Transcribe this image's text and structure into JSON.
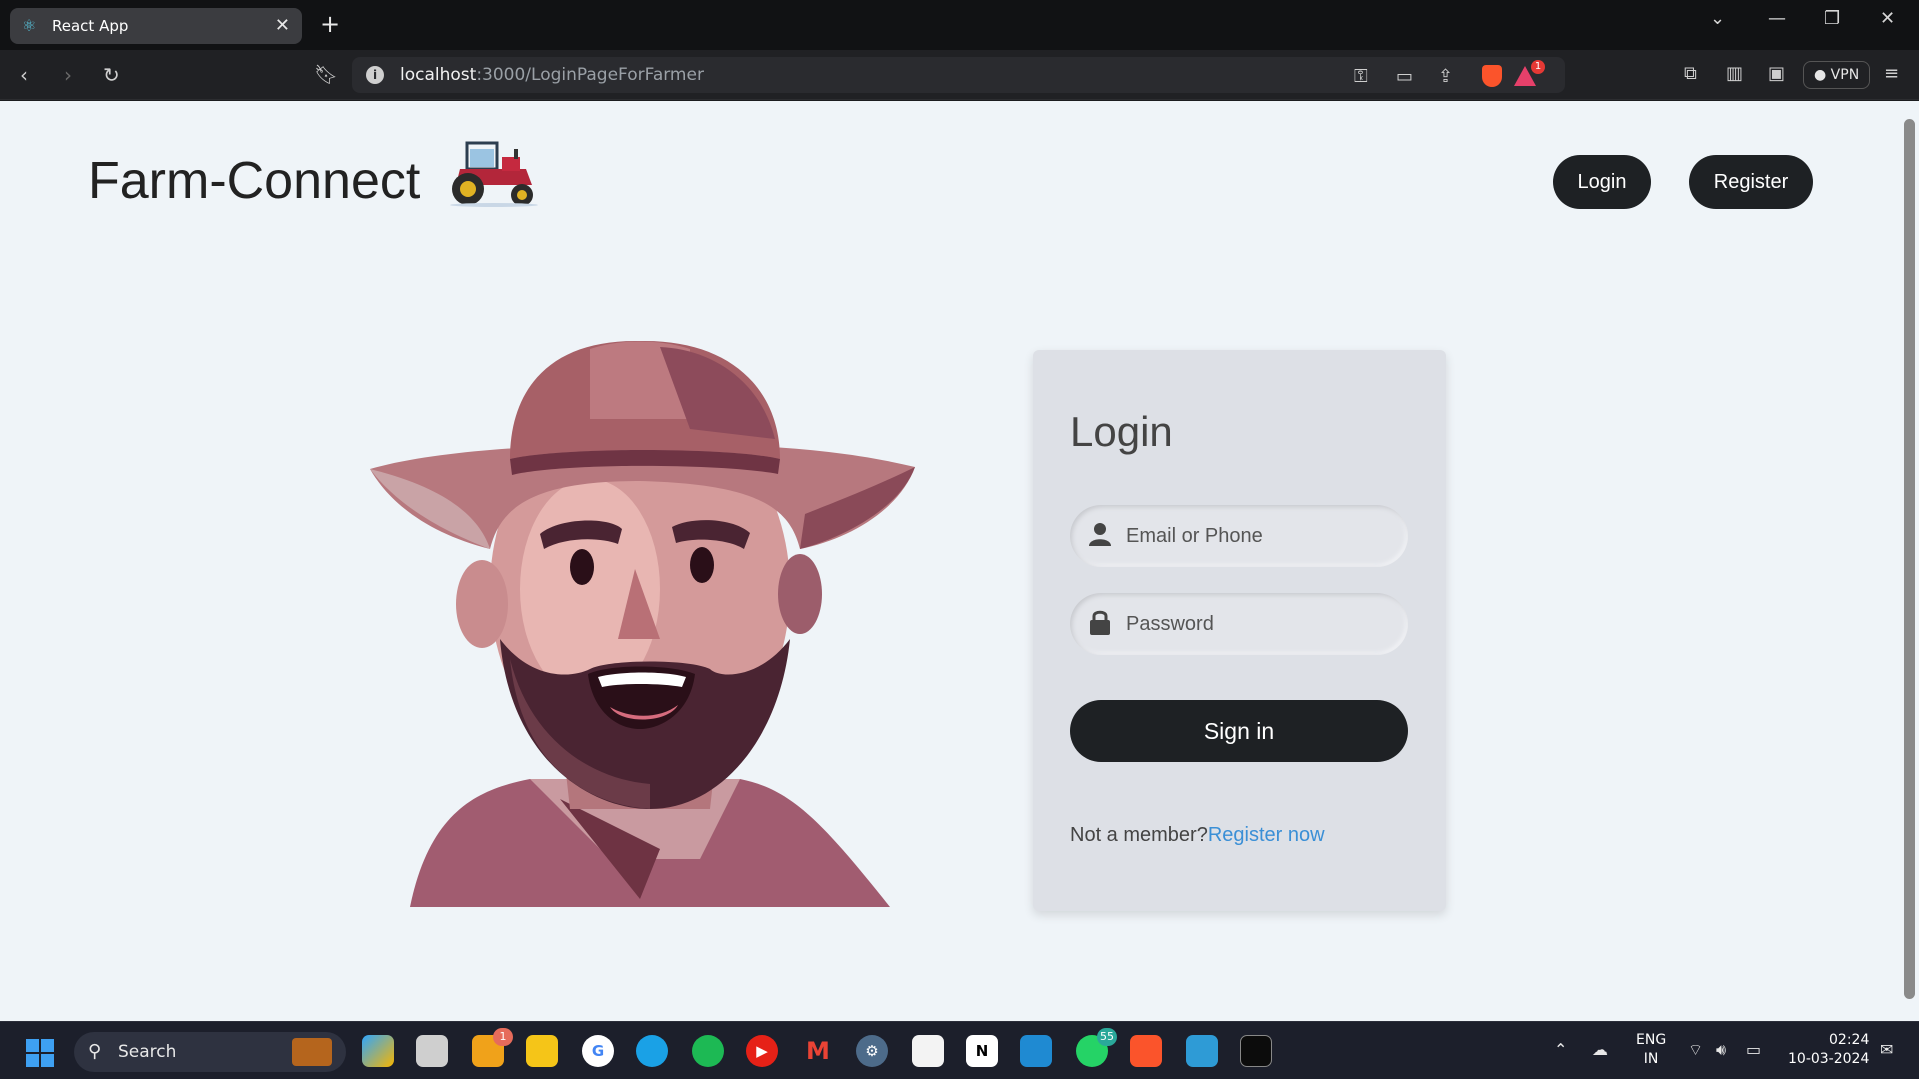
{
  "browser": {
    "tab_title": "React App",
    "url_host": "localhost",
    "url_rest": ":3000/LoginPageForFarmer",
    "vpn_label": "VPN",
    "rewards_count": "1"
  },
  "header": {
    "brand": "Farm-Connect",
    "login_label": "Login",
    "register_label": "Register"
  },
  "login_card": {
    "title": "Login",
    "email_placeholder": "Email or Phone",
    "password_placeholder": "Password",
    "signin_label": "Sign in",
    "not_member_text": "Not a member?",
    "register_link": "Register now"
  },
  "taskbar": {
    "search_label": "Search",
    "badge_mail": "1",
    "badge_whatsapp": "55",
    "lang_line1": "ENG",
    "lang_line2": "IN",
    "time": "02:24",
    "date": "10-03-2024"
  },
  "colors": {
    "page_bg": "#eff4f8",
    "button_dark": "#1e2124",
    "card_bg": "#dde0e6",
    "link": "#3a8fd6"
  }
}
